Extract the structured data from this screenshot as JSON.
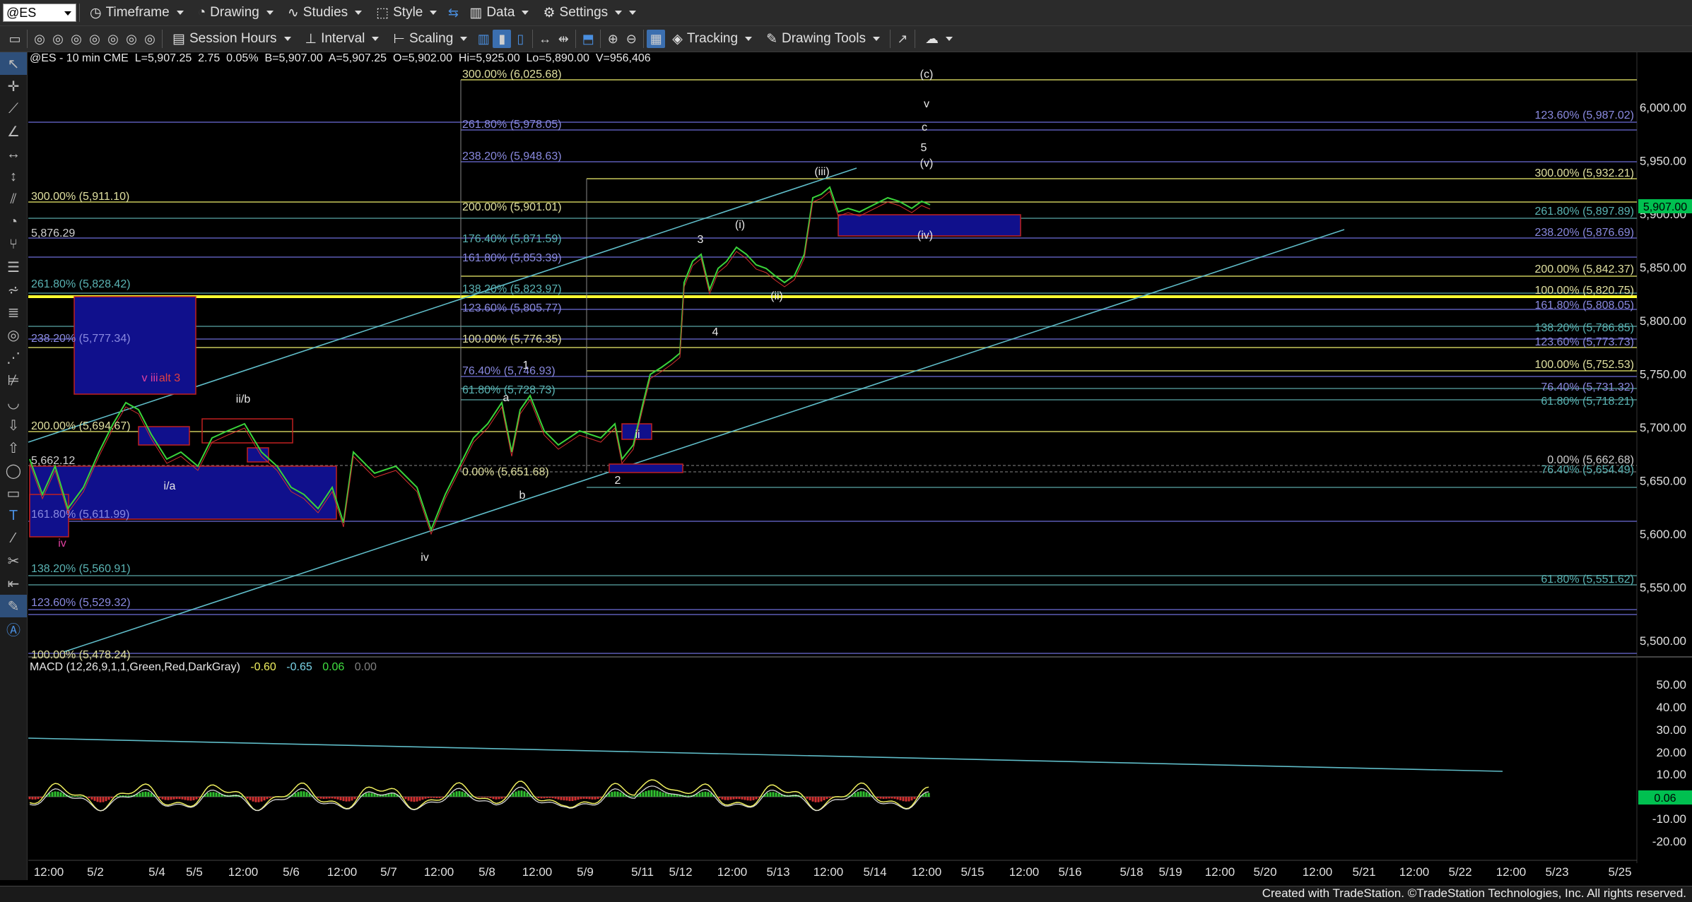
{
  "toolbar1": {
    "symbol": "@ES",
    "items": [
      "Timeframe",
      "Drawing",
      "Studies",
      "Style",
      "Data",
      "Settings"
    ]
  },
  "toolbar2": {
    "session": "Session Hours",
    "interval": "Interval",
    "scaling": "Scaling",
    "tracking": "Tracking",
    "drawing_tools": "Drawing Tools"
  },
  "info": {
    "symbol_line": "@ES - 10 min  CME",
    "last": "L=5,907.25",
    "chg": "2.75",
    "pct": "0.05%",
    "bid": "B=5,907.00",
    "ask": "A=5,907.25",
    "open": "O=5,902.00",
    "hi": "Hi=5,925.00",
    "lo": "Lo=5,890.00",
    "vol": "V=956,406"
  },
  "price_axis": [
    "6,000.00",
    "5,950.00",
    "5,900.00",
    "5,850.00",
    "5,800.00",
    "5,750.00",
    "5,700.00",
    "5,650.00",
    "5,600.00",
    "5,550.00",
    "5,500.00"
  ],
  "last_price_tag": "5,907.00",
  "macd": {
    "title": "MACD (12,26,9,1,1,Green,Red,DarkGray)",
    "v1": "-0.60",
    "v2": "-0.65",
    "v3": "0.06",
    "v4": "0.00",
    "axis": [
      "50.00",
      "40.00",
      "30.00",
      "20.00",
      "10.00",
      "-10.00",
      "-20.00"
    ],
    "tag": "0.06"
  },
  "time_axis": [
    "12:00",
    "5/2",
    "5/4",
    "5/5",
    "12:00",
    "5/6",
    "12:00",
    "5/7",
    "12:00",
    "5/8",
    "12:00",
    "5/9",
    "5/11",
    "5/12",
    "12:00",
    "5/13",
    "12:00",
    "5/14",
    "12:00",
    "5/15",
    "12:00",
    "5/16",
    "5/18",
    "5/19",
    "12:00",
    "5/20",
    "12:00",
    "5/21",
    "12:00",
    "5/22",
    "12:00",
    "5/23",
    "5/25"
  ],
  "fib_left": [
    "300.00% (5,911.10)",
    "5,876.29",
    "261.80% (5,828.42)",
    "238.20% (5,777.34)",
    "200.00% (5,694.67)",
    "5,662.12",
    "161.80% (5,611.99)",
    "138.20% (5,560.91)",
    "123.60% (5,529.32)",
    "100.00% (5,478.24)"
  ],
  "fib_mid": [
    "300.00% (6,025.68)",
    "261.80% (5,978.05)",
    "238.20% (5,948.63)",
    "200.00% (5,901.01)",
    "176.40% (5,871.59)",
    "161.80% (5,853.39)",
    "138.20% (5,823.97)",
    "123.60% (5,805.77)",
    "100.00% (5,776.35)",
    "76.40% (5,746.93)",
    "61.80% (5,728.73)",
    "0.00% (5,651.68)"
  ],
  "fib_right": [
    "123.60% (5,987.02)",
    "300.00% (5,932.21)",
    "261.80% (5,897.89)",
    "238.20% (5,876.69)",
    "200.00% (5,842.37)",
    "100.00% (5,820.75)",
    "161.80% (5,808.05)",
    "138.20% (5,786.85)",
    "123.60% (5,773.73)",
    "100.00% (5,752.53)",
    "76.40% (5,731.32)",
    "61.80% (5,718.21)",
    "0.00% (5,662.68)",
    "76.40% (5,654.49)",
    "61.80% (5,551.62)"
  ],
  "wave_labels": [
    "(c)",
    "v",
    "c",
    "5",
    "(v)",
    "(iii)",
    "(iv)",
    "(i)",
    "3",
    "(ii)",
    "4",
    "ii",
    "2",
    "1",
    "a",
    "b",
    "iv",
    "ii/b",
    "i/a",
    "iv",
    "v iii",
    "alt 3"
  ],
  "footer": "Created with TradeStation. ©TradeStation Technologies, Inc. All rights reserved."
}
